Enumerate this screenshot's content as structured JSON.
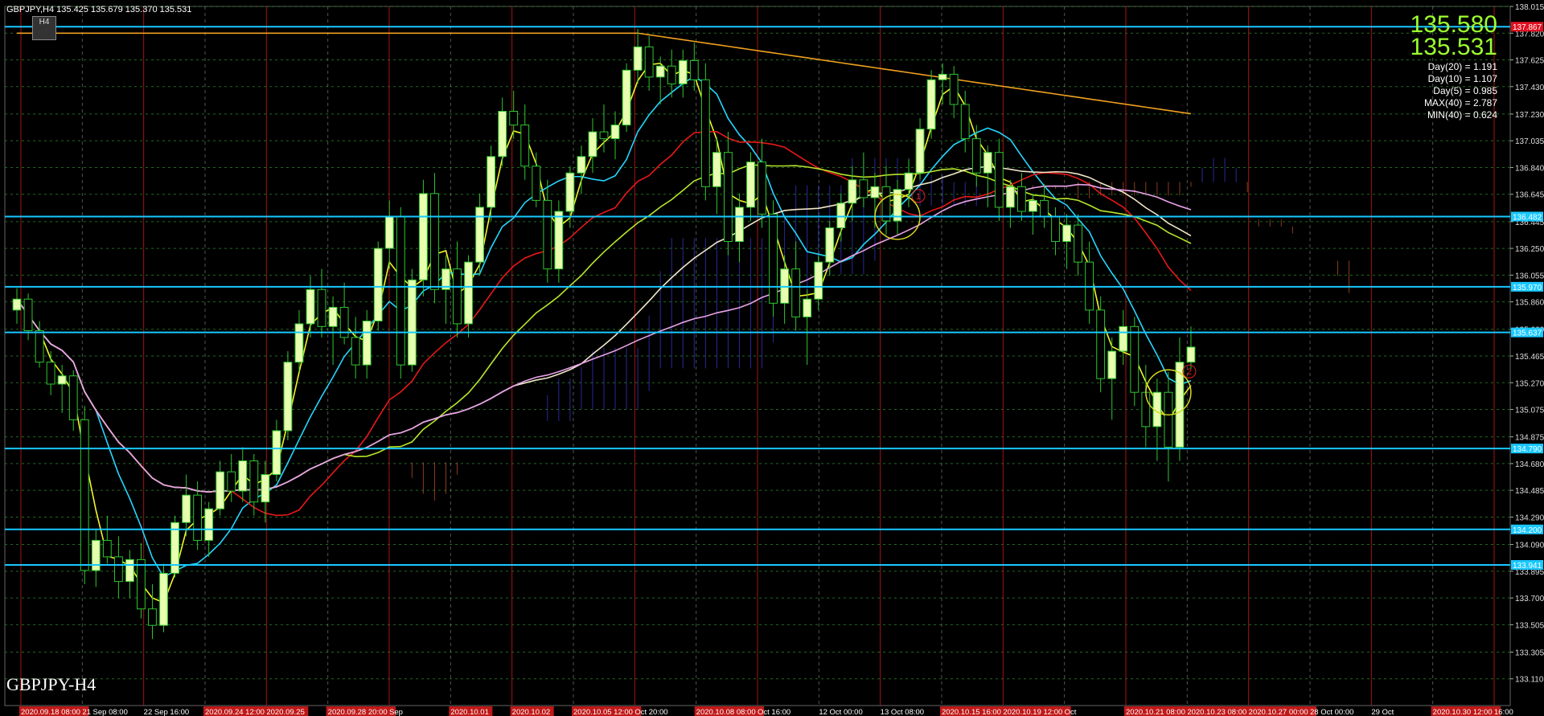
{
  "header": {
    "title": "GBPJPY,H4  135.425 135.679 135.370 135.531",
    "timeframe_button": "H4",
    "symbol_label": "GBPJPY-H4"
  },
  "quotes": {
    "bid": "135.580",
    "ask": "135.531"
  },
  "stats": [
    "Day(20) = 1.191",
    "Day(10) = 1.107",
    "Day(5) = 0.985",
    "MAX(40) = 2.787",
    "MIN(40) = 0.624"
  ],
  "chart_data": {
    "type": "candlestick",
    "ylim": [
      132.915,
      138.015
    ],
    "y_ticks": [
      "138.015",
      "137.820",
      "137.625",
      "137.430",
      "137.230",
      "137.035",
      "136.840",
      "136.645",
      "136.445",
      "136.250",
      "136.055",
      "135.860",
      "135.660",
      "135.465",
      "135.270",
      "135.075",
      "134.875",
      "134.680",
      "134.485",
      "134.290",
      "134.090",
      "133.895",
      "133.700",
      "133.505",
      "133.305",
      "133.110"
    ],
    "horizontal_levels": [
      {
        "label": "137.867",
        "value": 137.867,
        "color": "#19c8ff",
        "tag": "#e01020"
      },
      {
        "label": "136.482",
        "value": 136.482,
        "color": "#19c8ff",
        "tag": "#19c8ff"
      },
      {
        "label": "135.970",
        "value": 135.97,
        "color": "#19c8ff",
        "tag": "#19c8ff"
      },
      {
        "label": "135.637",
        "value": 135.637,
        "color": "#19c8ff",
        "tag": "#19c8ff"
      },
      {
        "label": "134.790",
        "value": 134.79,
        "color": "#19c8ff",
        "tag": "#19c8ff"
      },
      {
        "label": "134.200",
        "value": 134.2,
        "color": "#19c8ff",
        "tag": "#19c8ff"
      },
      {
        "label": "133.941",
        "value": 133.941,
        "color": "#19c8ff",
        "tag": "#19c8ff"
      }
    ],
    "x_labels": [
      "2020.09.18 08:00",
      "21 Sep 08:00",
      "22 Sep 16:00",
      "2020.09.24 12:00",
      "2020.09.25",
      "2020.09.28 20:00",
      "Sep",
      "2020.10.01",
      "2020.10.02",
      "2020.10.05 12:00",
      "Oct 20:00",
      "2020.10.08 08:00",
      "Oct 16:00",
      "12 Oct 00:00",
      "13 Oct 08:00",
      "2020.10.15 16:00",
      "2020.10.19 12:00",
      "Oct",
      "2020.10.21 08:00",
      "2020.10.23 08:00",
      "2020.10.27 00:00",
      "28 Oct 00:00",
      "29 Oct",
      "2020.10.30 12:00",
      "16:00"
    ],
    "annotations": [
      "1",
      "2"
    ],
    "candles": [
      [
        135.8,
        135.96,
        135.7,
        135.88
      ],
      [
        135.88,
        135.92,
        135.58,
        135.65
      ],
      [
        135.65,
        135.72,
        135.38,
        135.42
      ],
      [
        135.42,
        135.5,
        135.18,
        135.26
      ],
      [
        135.26,
        135.4,
        135.05,
        135.32
      ],
      [
        135.32,
        135.36,
        134.92,
        135.0
      ],
      [
        135.0,
        135.1,
        133.8,
        133.9
      ],
      [
        133.9,
        134.2,
        133.78,
        134.12
      ],
      [
        134.12,
        134.3,
        133.95,
        134.0
      ],
      [
        134.0,
        134.15,
        133.7,
        133.82
      ],
      [
        133.82,
        134.05,
        133.7,
        133.98
      ],
      [
        133.98,
        134.1,
        133.55,
        133.62
      ],
      [
        133.62,
        133.8,
        133.4,
        133.5
      ],
      [
        133.5,
        133.95,
        133.45,
        133.88
      ],
      [
        133.88,
        134.3,
        133.85,
        134.25
      ],
      [
        134.25,
        134.6,
        134.15,
        134.45
      ],
      [
        134.45,
        134.55,
        134.05,
        134.12
      ],
      [
        134.12,
        134.4,
        134.0,
        134.35
      ],
      [
        134.35,
        134.7,
        134.3,
        134.62
      ],
      [
        134.62,
        134.75,
        134.4,
        134.48
      ],
      [
        134.48,
        134.8,
        134.4,
        134.7
      ],
      [
        134.7,
        134.75,
        134.3,
        134.4
      ],
      [
        134.4,
        134.7,
        134.25,
        134.6
      ],
      [
        134.6,
        135.0,
        134.55,
        134.92
      ],
      [
        134.92,
        135.5,
        134.85,
        135.42
      ],
      [
        135.42,
        135.8,
        135.35,
        135.7
      ],
      [
        135.7,
        136.05,
        135.6,
        135.95
      ],
      [
        135.95,
        136.1,
        135.6,
        135.68
      ],
      [
        135.68,
        135.9,
        135.4,
        135.82
      ],
      [
        135.82,
        136.0,
        135.55,
        135.6
      ],
      [
        135.6,
        135.75,
        135.3,
        135.4
      ],
      [
        135.4,
        135.8,
        135.3,
        135.72
      ],
      [
        135.72,
        136.3,
        135.65,
        136.25
      ],
      [
        136.25,
        136.6,
        136.1,
        136.48
      ],
      [
        136.48,
        136.55,
        135.3,
        135.4
      ],
      [
        135.4,
        136.1,
        135.35,
        136.02
      ],
      [
        136.02,
        136.75,
        135.9,
        136.65
      ],
      [
        136.65,
        136.8,
        135.85,
        135.95
      ],
      [
        135.95,
        136.2,
        135.7,
        136.1
      ],
      [
        136.1,
        136.3,
        135.6,
        135.7
      ],
      [
        135.7,
        136.2,
        135.6,
        136.15
      ],
      [
        136.15,
        136.65,
        136.05,
        136.55
      ],
      [
        136.55,
        137.0,
        136.45,
        136.92
      ],
      [
        136.92,
        137.35,
        136.85,
        137.25
      ],
      [
        137.25,
        137.4,
        137.05,
        137.15
      ],
      [
        137.15,
        137.3,
        136.75,
        136.85
      ],
      [
        136.85,
        136.95,
        136.55,
        136.6
      ],
      [
        136.6,
        136.75,
        136.0,
        136.1
      ],
      [
        136.1,
        136.6,
        136.0,
        136.52
      ],
      [
        136.52,
        136.85,
        136.4,
        136.8
      ],
      [
        136.8,
        137.0,
        136.65,
        136.92
      ],
      [
        136.92,
        137.2,
        136.8,
        137.1
      ],
      [
        137.1,
        137.3,
        136.95,
        137.05
      ],
      [
        137.05,
        137.25,
        136.9,
        137.15
      ],
      [
        137.15,
        137.6,
        137.1,
        137.55
      ],
      [
        137.55,
        137.85,
        137.45,
        137.72
      ],
      [
        137.72,
        137.8,
        137.4,
        137.5
      ],
      [
        137.5,
        137.65,
        137.3,
        137.58
      ],
      [
        137.58,
        137.7,
        137.35,
        137.45
      ],
      [
        137.45,
        137.7,
        137.35,
        137.62
      ],
      [
        137.62,
        137.75,
        137.4,
        137.48
      ],
      [
        137.48,
        137.6,
        136.6,
        136.7
      ],
      [
        136.7,
        137.05,
        136.5,
        136.95
      ],
      [
        136.95,
        137.1,
        136.2,
        136.3
      ],
      [
        136.3,
        136.65,
        136.15,
        136.55
      ],
      [
        136.55,
        136.95,
        136.45,
        136.88
      ],
      [
        136.88,
        137.05,
        136.4,
        136.5
      ],
      [
        136.5,
        136.6,
        135.75,
        135.85
      ],
      [
        135.85,
        136.2,
        135.7,
        136.1
      ],
      [
        136.1,
        136.3,
        135.65,
        135.75
      ],
      [
        135.75,
        135.95,
        135.4,
        135.88
      ],
      [
        135.88,
        136.2,
        135.8,
        136.15
      ],
      [
        136.15,
        136.45,
        136.05,
        136.4
      ],
      [
        136.4,
        136.65,
        136.3,
        136.58
      ],
      [
        136.58,
        136.85,
        136.45,
        136.75
      ],
      [
        136.75,
        136.95,
        136.55,
        136.62
      ],
      [
        136.62,
        136.8,
        136.4,
        136.7
      ],
      [
        136.7,
        136.85,
        136.35,
        136.45
      ],
      [
        136.45,
        136.75,
        136.35,
        136.68
      ],
      [
        136.68,
        136.9,
        136.55,
        136.8
      ],
      [
        136.8,
        137.2,
        136.75,
        137.12
      ],
      [
        137.12,
        137.55,
        137.05,
        137.48
      ],
      [
        137.48,
        137.6,
        137.3,
        137.52
      ],
      [
        137.52,
        137.58,
        137.2,
        137.3
      ],
      [
        137.3,
        137.4,
        136.95,
        137.05
      ],
      [
        137.05,
        137.15,
        136.7,
        136.8
      ],
      [
        136.8,
        137.0,
        136.55,
        136.95
      ],
      [
        136.95,
        137.05,
        136.45,
        136.55
      ],
      [
        136.55,
        136.75,
        136.4,
        136.7
      ],
      [
        136.7,
        136.8,
        136.45,
        136.52
      ],
      [
        136.52,
        136.65,
        136.35,
        136.6
      ],
      [
        136.6,
        136.72,
        136.4,
        136.48
      ],
      [
        136.48,
        136.55,
        136.2,
        136.3
      ],
      [
        136.3,
        136.5,
        136.1,
        136.42
      ],
      [
        136.42,
        136.5,
        136.05,
        136.15
      ],
      [
        136.15,
        136.3,
        135.7,
        135.8
      ],
      [
        135.8,
        135.9,
        135.2,
        135.3
      ],
      [
        135.3,
        135.6,
        135.0,
        135.5
      ],
      [
        135.5,
        135.8,
        135.4,
        135.68
      ],
      [
        135.68,
        135.75,
        135.1,
        135.2
      ],
      [
        135.2,
        135.4,
        134.8,
        134.95
      ],
      [
        134.95,
        135.3,
        134.7,
        135.2
      ],
      [
        135.2,
        135.35,
        134.55,
        134.8
      ],
      [
        134.8,
        135.6,
        134.7,
        135.42
      ],
      [
        135.42,
        135.68,
        135.37,
        135.53
      ]
    ]
  }
}
